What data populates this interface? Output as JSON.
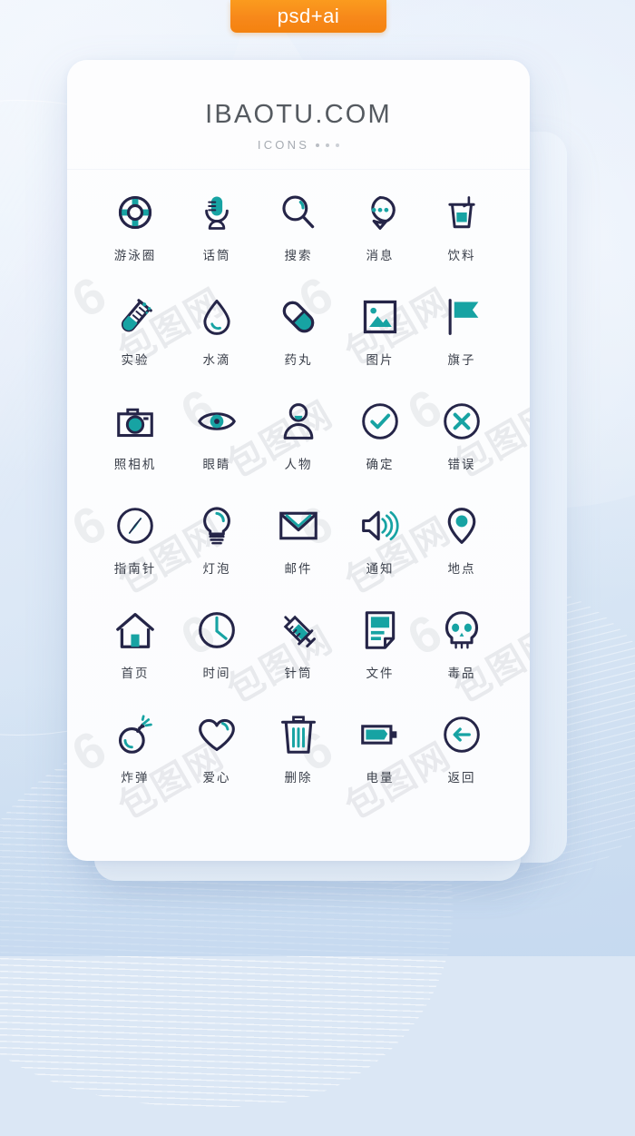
{
  "badge": {
    "label": "psd+ai"
  },
  "header": {
    "title": "IBAOTU.COM",
    "subtitle": "ICONS"
  },
  "colors": {
    "navy": "#252548",
    "teal": "#17a3a3",
    "badge_orange": "#f7881a",
    "card_white": "#fcfdfe",
    "background_blue": "#dbe7f5",
    "label_text": "#3a3f4a",
    "title_text": "#555a60",
    "subtitle_text": "#a6abb2"
  },
  "watermark": {
    "text": "包图网",
    "mark": "6"
  },
  "grid": {
    "columns": 5,
    "rows": 6,
    "icons": [
      {
        "label": "游泳圈",
        "icon": "lifebuoy-icon"
      },
      {
        "label": "话筒",
        "icon": "microphone-icon"
      },
      {
        "label": "搜索",
        "icon": "search-icon"
      },
      {
        "label": "消息",
        "icon": "message-icon"
      },
      {
        "label": "饮料",
        "icon": "drink-icon"
      },
      {
        "label": "实验",
        "icon": "test-tube-icon"
      },
      {
        "label": "水滴",
        "icon": "water-drop-icon"
      },
      {
        "label": "药丸",
        "icon": "pill-icon"
      },
      {
        "label": "图片",
        "icon": "image-icon"
      },
      {
        "label": "旗子",
        "icon": "flag-icon"
      },
      {
        "label": "照相机",
        "icon": "camera-icon"
      },
      {
        "label": "眼睛",
        "icon": "eye-icon"
      },
      {
        "label": "人物",
        "icon": "user-icon"
      },
      {
        "label": "确定",
        "icon": "check-circle-icon"
      },
      {
        "label": "错误",
        "icon": "close-circle-icon"
      },
      {
        "label": "指南针",
        "icon": "compass-icon"
      },
      {
        "label": "灯泡",
        "icon": "lightbulb-icon"
      },
      {
        "label": "邮件",
        "icon": "envelope-icon"
      },
      {
        "label": "通知",
        "icon": "speaker-icon"
      },
      {
        "label": "地点",
        "icon": "location-pin-icon"
      },
      {
        "label": "首页",
        "icon": "home-icon"
      },
      {
        "label": "时间",
        "icon": "clock-icon"
      },
      {
        "label": "针筒",
        "icon": "syringe-icon"
      },
      {
        "label": "文件",
        "icon": "document-icon"
      },
      {
        "label": "毒品",
        "icon": "skull-icon"
      },
      {
        "label": "炸弹",
        "icon": "bomb-icon"
      },
      {
        "label": "爱心",
        "icon": "heart-icon"
      },
      {
        "label": "删除",
        "icon": "trash-icon"
      },
      {
        "label": "电量",
        "icon": "battery-icon"
      },
      {
        "label": "返回",
        "icon": "back-arrow-icon"
      }
    ]
  }
}
